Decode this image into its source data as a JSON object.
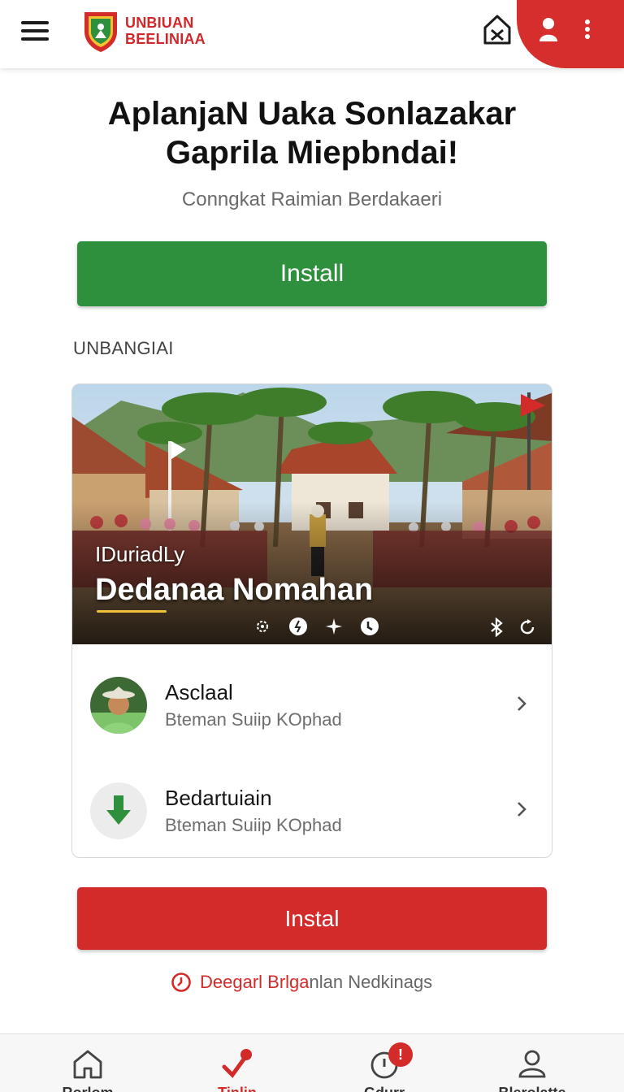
{
  "header": {
    "brand_line1": "UNBIUAN",
    "brand_line2": "BEELINIAA",
    "icons": [
      "menu-icon",
      "logo-shield",
      "home-icon",
      "user-icon",
      "more-vertical-icon"
    ],
    "accent_color": "#d62d2d"
  },
  "hero": {
    "title_line1": "AplanjaN Uaka Sonlazakar",
    "title_line2": "Gaprila Miepbndai!",
    "subtitle": "Conngkat Raimian Berdakaeri"
  },
  "primary_button": {
    "label": "Install",
    "color": "#2e8f3c"
  },
  "section_label": "UNBANGIAI",
  "card": {
    "photo_caption_small": "IDuriadLy",
    "photo_caption_big": "Dedanaa Nomahan",
    "photo_icons": [
      "settings-icon",
      "clock-icon",
      "sparkle-icon",
      "moon-icon",
      "bluetooth-icon",
      "refresh-icon"
    ],
    "rows": [
      {
        "title": "Asclaal",
        "subtitle": "Bteman Suiip KOphad",
        "icon": "farmer-avatar"
      },
      {
        "title": "Bedartuiain",
        "subtitle": "Bteman Suiip KOphad",
        "icon": "download-arrow-icon"
      }
    ]
  },
  "secondary_button": {
    "label": "Instal",
    "color": "#d32a2a"
  },
  "footer_link": {
    "red_part": "Deegarl Brlga",
    "grey_part": "nlan Nedkinags"
  },
  "bottom_nav": {
    "items": [
      {
        "label": "Rorlom",
        "icon": "home-icon"
      },
      {
        "label": "Tinlin",
        "icon": "pin-check-icon",
        "active": true
      },
      {
        "label": "Gdurr",
        "icon": "alert-circle-icon",
        "badge": "!"
      },
      {
        "label": "Blerolatte",
        "icon": "profile-icon"
      }
    ]
  }
}
